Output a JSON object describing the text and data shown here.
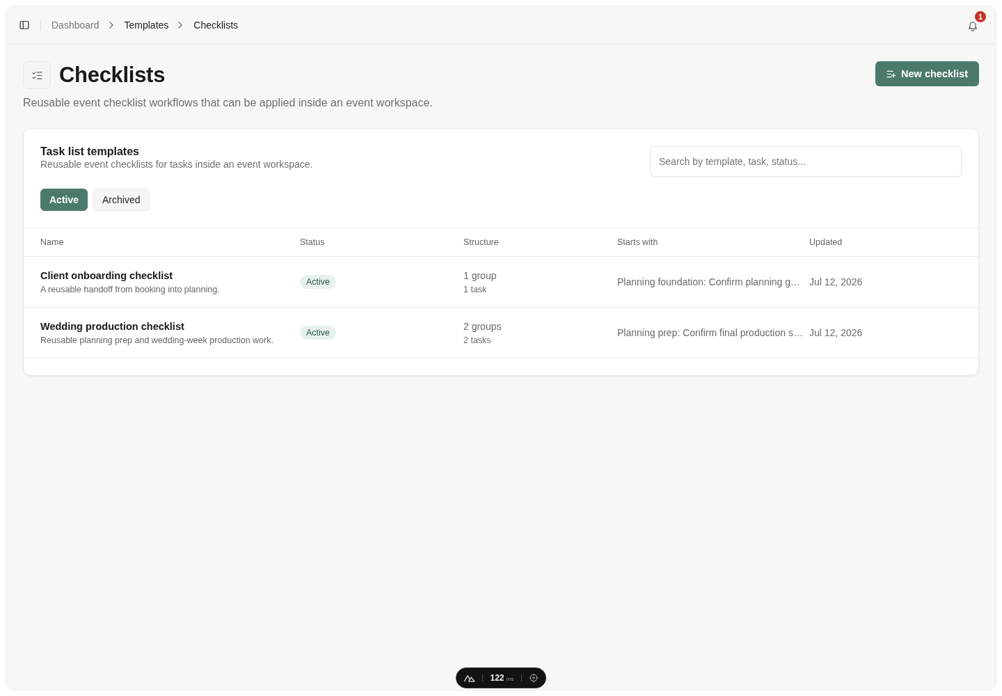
{
  "header": {
    "breadcrumbs": [
      {
        "label": "Dashboard",
        "muted": true
      },
      {
        "label": "Templates",
        "muted": false
      },
      {
        "label": "Checklists",
        "muted": false
      }
    ],
    "notifications": {
      "count": "1"
    }
  },
  "page": {
    "title": "Checklists",
    "subtitle": "Reusable event checklist workflows that can be applied inside an event workspace.",
    "primary_action": "New checklist"
  },
  "card": {
    "title": "Task list templates",
    "description": "Reusable event checklists for tasks inside an event workspace.",
    "search": {
      "placeholder": "Search by template, task, status..."
    },
    "filters": [
      {
        "label": "Active",
        "selected": true
      },
      {
        "label": "Archived",
        "selected": false
      }
    ],
    "table": {
      "columns": [
        "Name",
        "Status",
        "Structure",
        "Starts with",
        "Updated"
      ],
      "rows": [
        {
          "name": "Client onboarding checklist",
          "description": "A reusable handoff from booking into planning.",
          "status": "Active",
          "groups": "1 group",
          "tasks": "1 task",
          "starts_with": "Planning foundation: Confirm planning g…",
          "updated": "Jul 12, 2026"
        },
        {
          "name": "Wedding production checklist",
          "description": "Reusable planning prep and wedding-week production work.",
          "status": "Active",
          "groups": "2 groups",
          "tasks": "2 tasks",
          "starts_with": "Planning prep: Confirm final production s…",
          "updated": "Jul 12, 2026"
        }
      ]
    }
  },
  "devtools": {
    "time": "122",
    "unit": "ms"
  }
}
